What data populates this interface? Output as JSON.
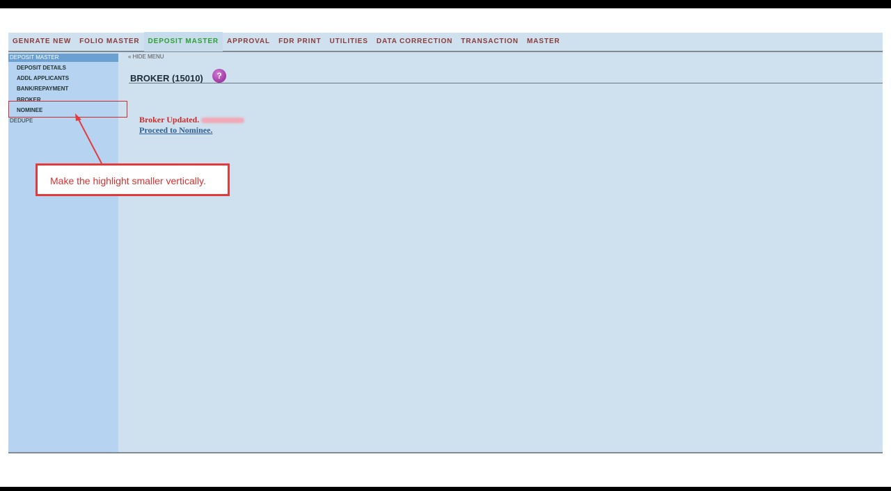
{
  "top_nav": {
    "items": [
      {
        "label": "GENRATE NEW"
      },
      {
        "label": "FOLIO MASTER"
      },
      {
        "label": "DEPOSIT MASTER"
      },
      {
        "label": "APPROVAL"
      },
      {
        "label": "FDR PRINT"
      },
      {
        "label": "UTILITIES"
      },
      {
        "label": "DATA CORRECTION"
      },
      {
        "label": "TRANSACTION"
      },
      {
        "label": "MASTER"
      }
    ],
    "active": "DEPOSIT MASTER"
  },
  "sidebar": {
    "heading": "DEPOSIT MASTER",
    "items": [
      {
        "label": "DEPOSIT DETAILS"
      },
      {
        "label": "ADDL APPLICANTS"
      },
      {
        "label": "BANK/REPAYMENT"
      },
      {
        "label": "BROKER"
      },
      {
        "label": "NOMINEE"
      }
    ],
    "dedupe": "DEDUPE"
  },
  "main": {
    "hide_menu": "« HIDE MENU",
    "title": "BROKER (15010)",
    "help_icon_glyph": "?",
    "message": "Broker Updated.",
    "link": "Proceed to Nominee."
  },
  "annotation": {
    "text": "Make the highlight smaller vertically."
  },
  "colors": {
    "nav_text": "#8a3a3a",
    "nav_active": "#2f9f2f",
    "sidebar_bg": "#b6d4f2",
    "main_bg": "#cfe0ee",
    "message": "#cc2b2b",
    "link": "#2d5f96",
    "annotation_red": "#e33b3b"
  },
  "icons": {
    "help": "help-icon"
  }
}
